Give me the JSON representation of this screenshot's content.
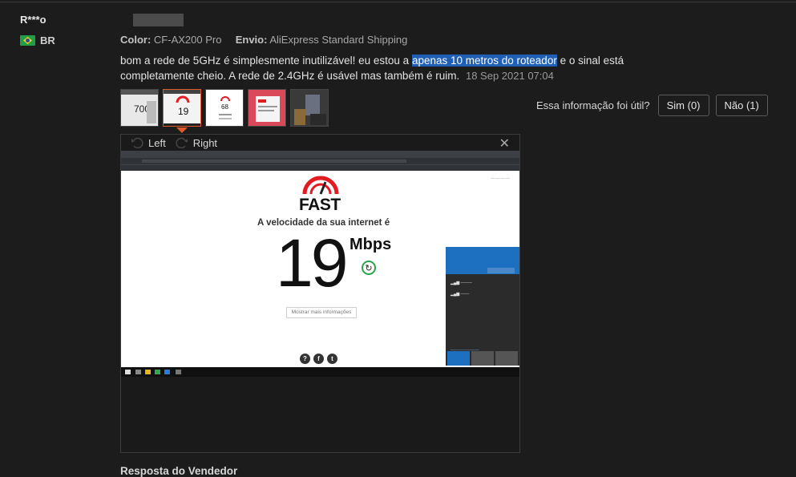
{
  "review": {
    "username": "R***o",
    "country_code": "BR",
    "color_label": "Color:",
    "color_value": "CF-AX200 Pro",
    "shipping_label": "Envio:",
    "shipping_value": "AliExpress Standard Shipping",
    "text_before": "bom a rede de 5GHz é simplesmente inutilizável! eu estou a ",
    "text_highlight": "apenas 10 metros do roteador",
    "text_after": " e o sinal está completamente cheio. A rede de 2.4GHz é usável mas também é ruim.",
    "date": "18 Sep 2021 07:04"
  },
  "helpful": {
    "question": "Essa informação foi útil?",
    "yes_label": "Sim (0)",
    "no_label": "Não (1)"
  },
  "thumbnails": [
    {
      "name": "photo-1",
      "caption": "700"
    },
    {
      "name": "photo-2",
      "caption": "19",
      "active": true
    },
    {
      "name": "photo-3",
      "caption": "68"
    },
    {
      "name": "photo-4",
      "caption": ""
    },
    {
      "name": "photo-5",
      "caption": ""
    }
  ],
  "viewer": {
    "rotate_left_label": "Left",
    "rotate_right_label": "Right",
    "close_icon": "close-icon",
    "screenshot": {
      "logo_text": "FAST",
      "heading": "A velocidade da sua internet é",
      "speed_value": "19",
      "speed_unit": "Mbps",
      "more_info": "Mostrar mais informações"
    }
  },
  "seller_response_title": "Resposta do Vendedor",
  "colors": {
    "background": "#1c1c1c",
    "highlight": "#1f5fb5",
    "active_thumb_border": "#e0592a",
    "fast_red": "#e31b23"
  }
}
